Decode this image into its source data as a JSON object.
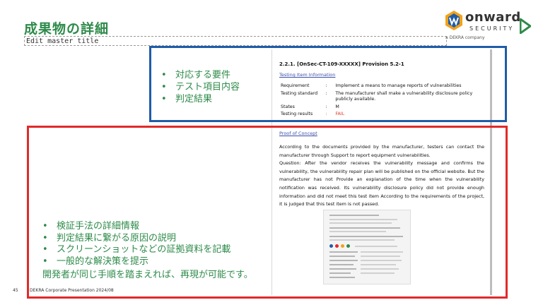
{
  "slide": {
    "title": "成果物の詳細",
    "master_placeholder": "Edit master title"
  },
  "logo": {
    "word": "onward",
    "sub": "SECURITY",
    "tag": "a DEKRA company",
    "colors": {
      "orange": "#f2a21a",
      "blue": "#1f5ca8",
      "green": "#2e8b4a"
    }
  },
  "document": {
    "section": "2.2.1. [OnSec-CT-109-XXXXX] Provision 5.2-1",
    "testing_item_heading": "Testing Item Information",
    "rows": [
      {
        "key": "Requirement",
        "colon": ":",
        "value": "Implement a means to manage reports of vulnerabilities"
      },
      {
        "key": "Testing standard",
        "colon": ":",
        "value": "The manufacturer shall make a vulnerability disclosure policy publicly available."
      },
      {
        "key": "States",
        "colon": ":",
        "value": "M"
      },
      {
        "key": "Testing results",
        "colon": ":",
        "value": "FAIL"
      }
    ],
    "proof_heading": "Proof of Concept",
    "paragraph": [
      "According to the documents provided by the manufacturer, testers can contact the manufacturer through        Support to report equipment vulnerabilities.",
      "Question: After the vendor receives the vulnerability message and confirms the vulnerability, the vulnerability repair plan will be published on the official website. But the manufacturer has not Provide an explanation of the time when the vulnerability notification was received. Its vulnerability disclosure policy did not provide enough information and did not meet this test item According to the requirements of the project, it is judged that this test item is not passed."
    ]
  },
  "blue_box": {
    "items": [
      "対応する要件",
      "テスト項目内容",
      "判定結果"
    ],
    "color": "#1f5ca8"
  },
  "red_box": {
    "items": [
      "検証手法の詳細情報",
      "判定結果に繋がる原因の説明",
      "スクリーンショットなどの証拠資料を記載",
      "一般的な解決策を提示"
    ],
    "note": "開発者が同じ手順を踏まえれば、再現が可能です。",
    "color": "#e12a2a"
  },
  "footer": {
    "page": "45",
    "text": "DEKRA Corporate Presentation 2024/08"
  }
}
